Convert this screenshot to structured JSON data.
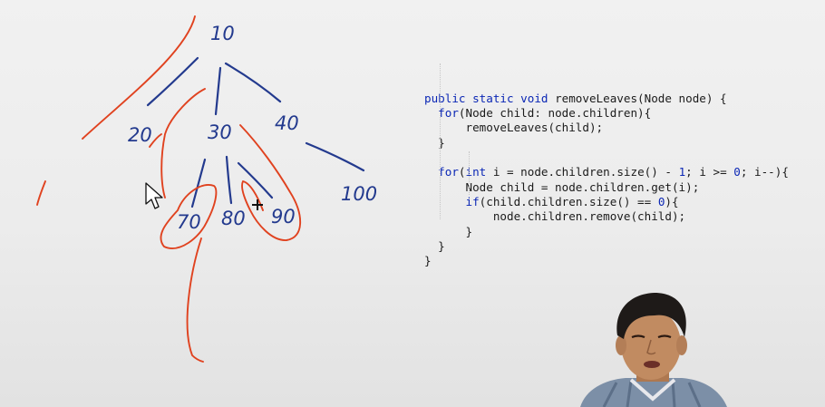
{
  "tree": {
    "nodes": [
      {
        "id": "root",
        "label": "10"
      },
      {
        "id": "n20",
        "label": "20"
      },
      {
        "id": "n30",
        "label": "30"
      },
      {
        "id": "n40",
        "label": "40"
      },
      {
        "id": "n70",
        "label": "70"
      },
      {
        "id": "n80",
        "label": "80"
      },
      {
        "id": "n90",
        "label": "90"
      },
      {
        "id": "n100",
        "label": "100"
      }
    ]
  },
  "code": {
    "lines": [
      [
        {
          "t": "public static void ",
          "k": "kw"
        },
        {
          "t": "removeLeaves(Node node) {",
          "k": ""
        }
      ],
      [
        {
          "t": "  for",
          "k": "kw"
        },
        {
          "t": "(Node child: node.children){",
          "k": ""
        }
      ],
      [
        {
          "t": "      removeLeaves(child);",
          "k": ""
        }
      ],
      [
        {
          "t": "  }",
          "k": ""
        }
      ],
      [
        {
          "t": "",
          "k": ""
        }
      ],
      [
        {
          "t": "  for",
          "k": "kw"
        },
        {
          "t": "(",
          "k": ""
        },
        {
          "t": "int",
          "k": "kw"
        },
        {
          "t": " i = node.children.size() - ",
          "k": ""
        },
        {
          "t": "1",
          "k": "num"
        },
        {
          "t": "; i >= ",
          "k": ""
        },
        {
          "t": "0",
          "k": "num"
        },
        {
          "t": "; i--){",
          "k": ""
        }
      ],
      [
        {
          "t": "      Node child = node.children.get(i);",
          "k": ""
        }
      ],
      [
        {
          "t": "      if",
          "k": "kw"
        },
        {
          "t": "(child.children.size() == ",
          "k": ""
        },
        {
          "t": "0",
          "k": "num"
        },
        {
          "t": "){",
          "k": ""
        }
      ],
      [
        {
          "t": "          node.children.remove(child);",
          "k": ""
        }
      ],
      [
        {
          "t": "      }",
          "k": ""
        }
      ],
      [
        {
          "t": "  }",
          "k": ""
        }
      ],
      [
        {
          "t": "}",
          "k": ""
        }
      ]
    ]
  },
  "colors": {
    "ink_blue": "#233a8e",
    "ink_red": "#e0421f",
    "keyword": "#0b27b5"
  },
  "icons": {
    "cursor": "mouse-pointer-icon",
    "crosshair": "crosshair-icon"
  }
}
